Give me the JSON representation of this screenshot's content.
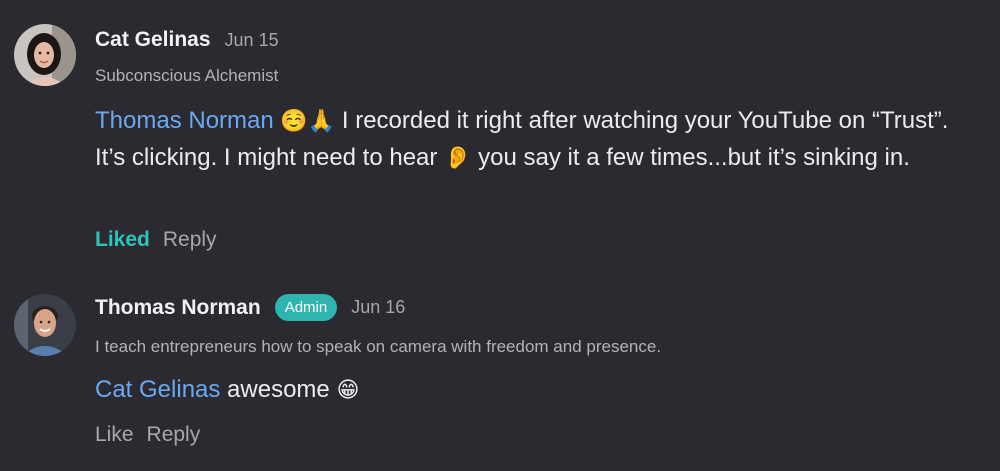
{
  "comments": [
    {
      "author": "Cat Gelinas",
      "date": "Jun 15",
      "bio": "Subconscious Alchemist",
      "mention": "Thomas Norman",
      "emoji_1": "☺️🙏",
      "text_1": " I recorded it right after watching your YouTube on “Trust”.  It’s clicking.  I might need to hear ",
      "emoji_2": "👂",
      "text_2": " you say it a few times...but it’s sinking in.",
      "like_label": "Liked",
      "reply_label": "Reply"
    },
    {
      "author": "Thomas Norman",
      "badge": "Admin",
      "date": "Jun 16",
      "bio": "I teach entrepreneurs how to speak on camera with freedom and presence.",
      "mention": "Cat Gelinas",
      "text_1": " awesome ",
      "emoji_1": "😁",
      "like_label": "Like",
      "reply_label": "Reply"
    }
  ],
  "colors": {
    "background": "#2b2a30",
    "mention": "#6aa9f2",
    "accent_teal": "#2fb5b0",
    "liked": "#2fc4b8"
  }
}
